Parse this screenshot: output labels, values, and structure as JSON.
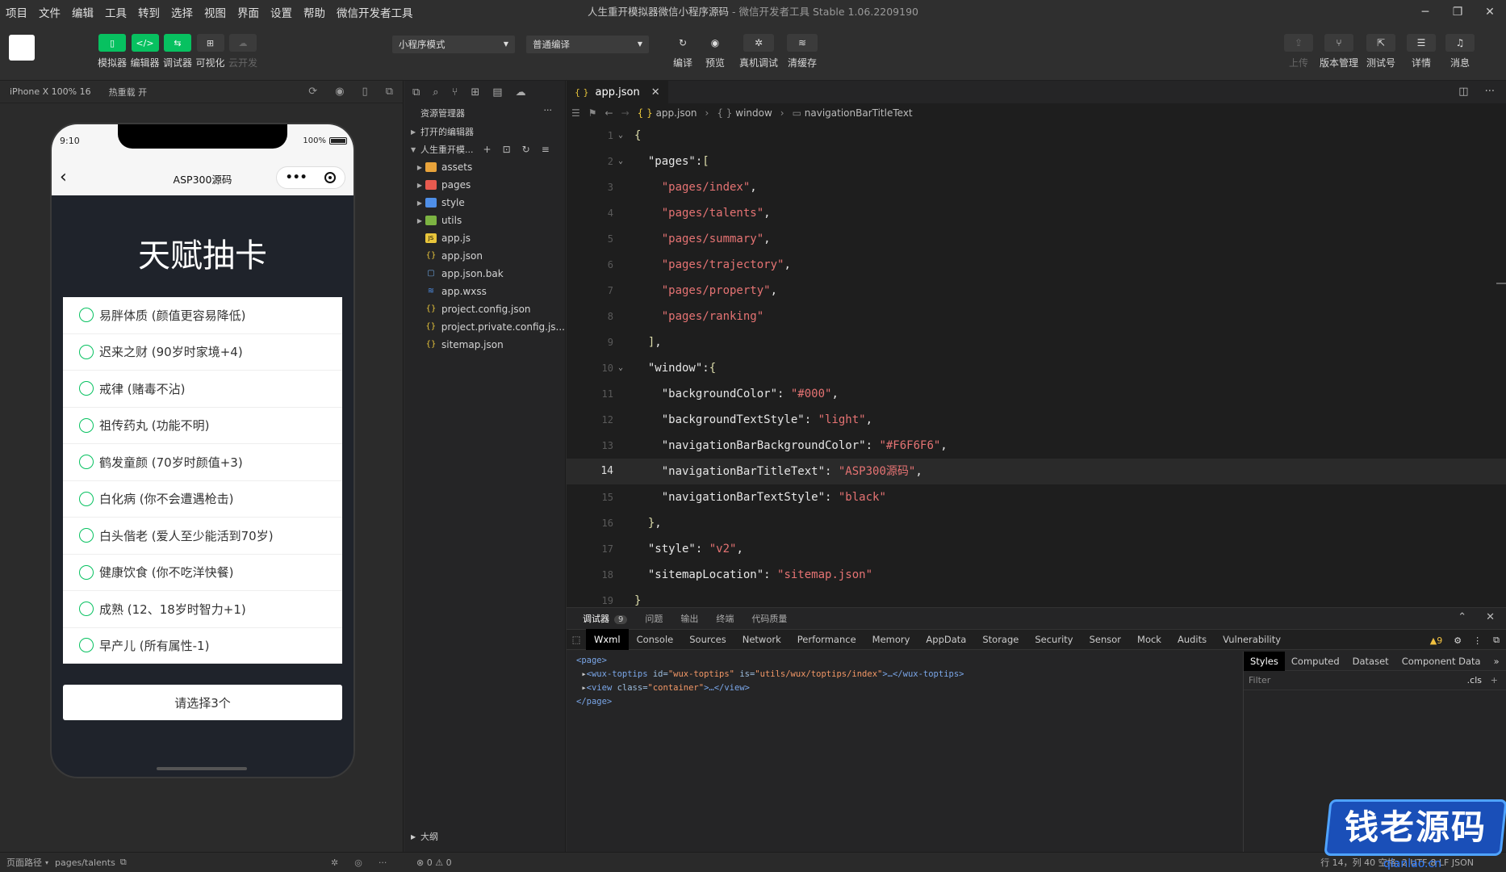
{
  "menu": [
    "项目",
    "文件",
    "编辑",
    "工具",
    "转到",
    "选择",
    "视图",
    "界面",
    "设置",
    "帮助",
    "微信开发者工具"
  ],
  "window": {
    "title": "人生重开模拟器微信小程序源码",
    "subtitle": "- 微信开发者工具 Stable 1.06.2209190"
  },
  "toolbar": {
    "left": [
      {
        "label": "模拟器",
        "icon": "phone-icon"
      },
      {
        "label": "编辑器",
        "icon": "code-icon"
      },
      {
        "label": "调试器",
        "icon": "debug-icon"
      },
      {
        "label": "可视化",
        "icon": "layout-icon"
      },
      {
        "label": "云开发",
        "icon": "cloud-icon"
      }
    ],
    "mode_select": "小程序模式",
    "compile_select": "普通编译",
    "center": [
      {
        "label": "编译",
        "icon": "refresh-icon"
      },
      {
        "label": "预览",
        "icon": "eye-icon"
      },
      {
        "label": "真机调试",
        "icon": "bug-icon"
      },
      {
        "label": "清缓存",
        "icon": "layers-icon"
      }
    ],
    "right": [
      {
        "label": "上传",
        "icon": "upload-icon"
      },
      {
        "label": "版本管理",
        "icon": "branch-icon"
      },
      {
        "label": "测试号",
        "icon": "external-icon"
      },
      {
        "label": "详情",
        "icon": "menu-icon"
      },
      {
        "label": "消息",
        "icon": "bell-icon"
      }
    ]
  },
  "simulator": {
    "device": "iPhone X 100% 16",
    "hot_reload": "热重载 开",
    "time": "9:10",
    "battery": "100%",
    "nav_title": "ASP300源码",
    "page_title": "天赋抽卡",
    "items": [
      "易胖体质 (颜值更容易降低)",
      "迟来之财 (90岁时家境+4)",
      "戒律 (赌毒不沾)",
      "祖传药丸 (功能不明)",
      "鹤发童颜 (70岁时颜值+3)",
      "白化病 (你不会遭遇枪击)",
      "白头偕老 (爱人至少能活到70岁)",
      "健康饮食 (你不吃洋快餐)",
      "成熟 (12、18岁时智力+1)",
      "早产儿 (所有属性-1)"
    ],
    "button": "请选择3个"
  },
  "explorer": {
    "title": "资源管理器",
    "open_editors": "打开的编辑器",
    "project": "人生重开模...",
    "files": [
      {
        "name": "assets",
        "type": "folder",
        "color": "#e8a33b"
      },
      {
        "name": "pages",
        "type": "folder",
        "color": "#e85a4f"
      },
      {
        "name": "style",
        "type": "folder",
        "color": "#4f8fe8"
      },
      {
        "name": "utils",
        "type": "folder",
        "color": "#7cb342"
      },
      {
        "name": "app.js",
        "type": "js",
        "color": "#e8c53b"
      },
      {
        "name": "app.json",
        "type": "json",
        "color": "#e8c53b"
      },
      {
        "name": "app.json.bak",
        "type": "file",
        "color": "#6a9fd8"
      },
      {
        "name": "app.wxss",
        "type": "wxss",
        "color": "#4f8fe8"
      },
      {
        "name": "project.config.json",
        "type": "json",
        "color": "#e8c53b"
      },
      {
        "name": "project.private.config.js...",
        "type": "json",
        "color": "#e8c53b"
      },
      {
        "name": "sitemap.json",
        "type": "json",
        "color": "#e8c53b"
      }
    ],
    "outline": "大纲"
  },
  "editor": {
    "tab": "app.json",
    "breadcrumb": [
      "app.json",
      "window",
      "navigationBarTitleText"
    ],
    "current_line": 14,
    "lines": [
      {
        "n": "1",
        "fold": true,
        "parts": [
          [
            "p",
            "{"
          ]
        ]
      },
      {
        "n": "2",
        "fold": true,
        "parts": [
          [
            "k",
            "  \"pages\":"
          ],
          [
            "p",
            "["
          ]
        ]
      },
      {
        "n": "3",
        "parts": [
          [
            "s",
            "    \"pages/index\""
          ],
          [
            "k",
            ","
          ]
        ]
      },
      {
        "n": "4",
        "parts": [
          [
            "s",
            "    \"pages/talents\""
          ],
          [
            "k",
            ","
          ]
        ]
      },
      {
        "n": "5",
        "parts": [
          [
            "s",
            "    \"pages/summary\""
          ],
          [
            "k",
            ","
          ]
        ]
      },
      {
        "n": "6",
        "parts": [
          [
            "s",
            "    \"pages/trajectory\""
          ],
          [
            "k",
            ","
          ]
        ]
      },
      {
        "n": "7",
        "parts": [
          [
            "s",
            "    \"pages/property\""
          ],
          [
            "k",
            ","
          ]
        ]
      },
      {
        "n": "8",
        "parts": [
          [
            "s",
            "    \"pages/ranking\""
          ]
        ]
      },
      {
        "n": "9",
        "parts": [
          [
            "p",
            "  ]"
          ],
          [
            "k",
            ","
          ]
        ]
      },
      {
        "n": "10",
        "fold": true,
        "parts": [
          [
            "k",
            "  \"window\":"
          ],
          [
            "p",
            "{"
          ]
        ]
      },
      {
        "n": "11",
        "parts": [
          [
            "k",
            "    \"backgroundColor\": "
          ],
          [
            "s",
            "\"#000\""
          ],
          [
            "k",
            ","
          ]
        ]
      },
      {
        "n": "12",
        "parts": [
          [
            "k",
            "    \"backgroundTextStyle\": "
          ],
          [
            "s",
            "\"light\""
          ],
          [
            "k",
            ","
          ]
        ]
      },
      {
        "n": "13",
        "parts": [
          [
            "k",
            "    \"navigationBarBackgroundColor\": "
          ],
          [
            "s",
            "\"#F6F6F6\""
          ],
          [
            "k",
            ","
          ]
        ]
      },
      {
        "n": "14",
        "parts": [
          [
            "k",
            "    \"navigationBarTitleText\": "
          ],
          [
            "s",
            "\"ASP300源码\""
          ],
          [
            "k",
            ","
          ]
        ]
      },
      {
        "n": "15",
        "parts": [
          [
            "k",
            "    \"navigationBarTextStyle\": "
          ],
          [
            "s",
            "\"black\""
          ]
        ]
      },
      {
        "n": "16",
        "parts": [
          [
            "p",
            "  }"
          ],
          [
            "k",
            ","
          ]
        ]
      },
      {
        "n": "17",
        "parts": [
          [
            "k",
            "  \"style\": "
          ],
          [
            "s",
            "\"v2\""
          ],
          [
            "k",
            ","
          ]
        ]
      },
      {
        "n": "18",
        "parts": [
          [
            "k",
            "  \"sitemapLocation\": "
          ],
          [
            "s",
            "\"sitemap.json\""
          ]
        ]
      },
      {
        "n": "19",
        "parts": [
          [
            "p",
            "}"
          ]
        ]
      }
    ]
  },
  "debugger": {
    "tabs": [
      "调试器",
      "问题",
      "输出",
      "终端",
      "代码质量"
    ],
    "badge": "9",
    "devtools_tabs": [
      "Wxml",
      "Console",
      "Sources",
      "Network",
      "Performance",
      "Memory",
      "AppData",
      "Storage",
      "Security",
      "Sensor",
      "Mock",
      "Audits",
      "Vulnerability"
    ],
    "warnings": "▲9",
    "dom": {
      "page_open": "<page>",
      "toptips": [
        "<wux-toptips ",
        "id=",
        "\"wux-toptips\"",
        " is=",
        "\"utils/wux/toptips/index\"",
        ">…</wux-toptips>"
      ],
      "view": [
        "<view ",
        "class=",
        "\"container\"",
        ">…</view>"
      ],
      "page_close": "</page>"
    },
    "styles_tabs": [
      "Styles",
      "Computed",
      "Dataset",
      "Component Data"
    ],
    "filter_placeholder": "Filter",
    "cls": ".cls"
  },
  "statusbar": {
    "path_label": "页面路径",
    "path": "pages/talents",
    "errors": "⊗ 0 ⚠ 0",
    "right": "行 14，列 40   空格: 2   UTF-8   LF   JSON"
  },
  "watermark": {
    "text": "钱老源码",
    "url": "qianlao.cn"
  }
}
